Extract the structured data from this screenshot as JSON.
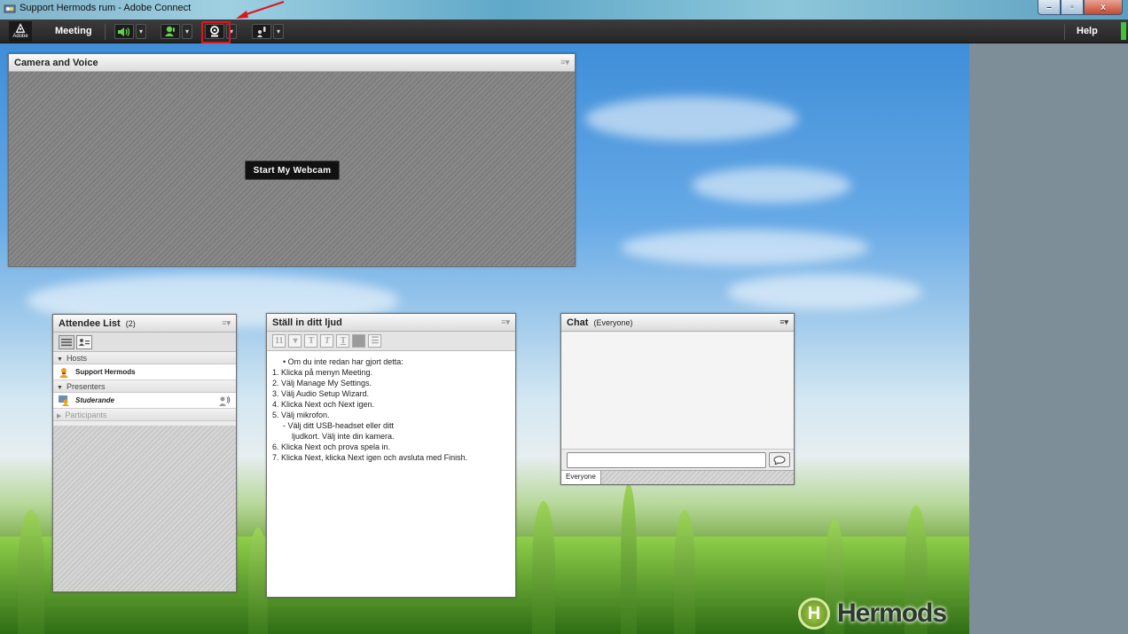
{
  "window": {
    "title": "Support Hermods rum - Adobe Connect",
    "controls": {
      "minimize": "–",
      "maximize": "▫",
      "close": "x"
    }
  },
  "toolbar": {
    "logo_text": "Adobe",
    "meeting_label": "Meeting",
    "help_label": "Help",
    "buttons": [
      {
        "name": "speaker",
        "icon": "speaker-icon",
        "status": "on"
      },
      {
        "name": "microphone",
        "icon": "microphone-icon",
        "status": "on"
      },
      {
        "name": "webcam",
        "icon": "webcam-icon",
        "status": "off",
        "highlighted": true
      },
      {
        "name": "raise-hand",
        "icon": "raise-hand-icon",
        "status": "off"
      }
    ],
    "accent_green": "#3fc33a",
    "highlight_color": "#e0141a"
  },
  "camera_pod": {
    "title": "Camera and Voice",
    "start_button": "Start My Webcam"
  },
  "attendee_pod": {
    "title": "Attendee List",
    "count": "(2)",
    "sections": {
      "hosts": "Hosts",
      "presenters": "Presenters",
      "participants": "Participants"
    },
    "hosts": [
      "Support Hermods"
    ],
    "presenters": [
      "Studerande"
    ]
  },
  "notes_pod": {
    "title": "Ställ in ditt ljud",
    "font_size": "11",
    "lines": [
      "•   Om du inte redan har gjort detta:",
      "1. Klicka på menyn Meeting.",
      "2. Välj Manage My Settings.",
      "3. Välj Audio Setup Wizard.",
      "4. Klicka Next och Next igen.",
      "5. Välj mikrofon.",
      "- Välj ditt USB-headset eller ditt",
      "ljudkort. Välj inte din kamera.",
      "6. Klicka Next och prova spela in.",
      "7. Klicka Next, klicka Next igen och avsluta med Finish."
    ]
  },
  "chat_pod": {
    "title": "Chat",
    "scope": "(Everyone)",
    "tab_everyone": "Everyone",
    "input_value": ""
  },
  "branding": {
    "logo_letter": "H",
    "logo_text": "Hermods"
  }
}
